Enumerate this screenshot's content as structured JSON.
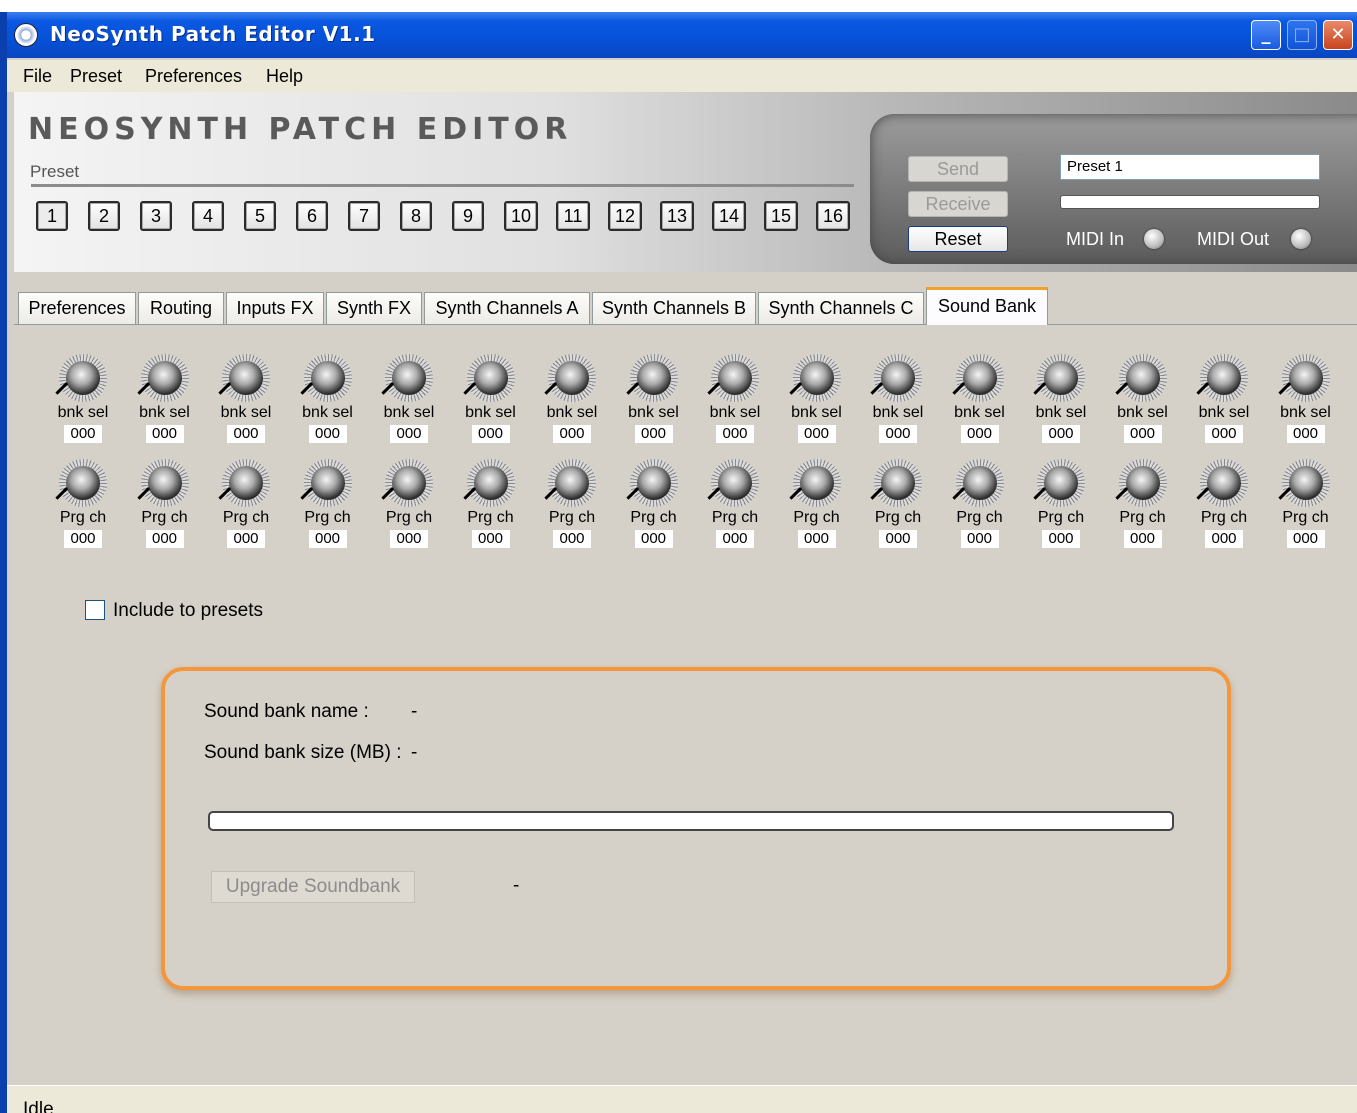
{
  "window": {
    "title": "NeoSynth Patch Editor V1.1"
  },
  "menu": [
    "File",
    "Preset",
    "Preferences",
    "Help"
  ],
  "header": {
    "banner_title": "NEOSYNTH PATCH EDITOR",
    "preset_label": "Preset",
    "preset_buttons": [
      "1",
      "2",
      "3",
      "4",
      "5",
      "6",
      "7",
      "8",
      "9",
      "10",
      "11",
      "12",
      "13",
      "14",
      "15",
      "16"
    ],
    "active_preset": "1",
    "send_label": "Send",
    "receive_label": "Receive",
    "reset_label": "Reset",
    "preset_name": "Preset 1",
    "midi_in_label": "MIDI In",
    "midi_out_label": "MIDI Out"
  },
  "tabs": [
    "Preferences",
    "Routing",
    "Inputs FX",
    "Synth FX",
    "Synth Channels A",
    "Synth Channels B",
    "Synth Channels C",
    "Sound Bank"
  ],
  "active_tab": "Sound Bank",
  "sound_bank": {
    "bank_select": {
      "label": "bnk sel",
      "values": [
        "000",
        "000",
        "000",
        "000",
        "000",
        "000",
        "000",
        "000",
        "000",
        "000",
        "000",
        "000",
        "000",
        "000",
        "000",
        "000"
      ]
    },
    "program_change": {
      "label": "Prg ch",
      "values": [
        "000",
        "000",
        "000",
        "000",
        "000",
        "000",
        "000",
        "000",
        "000",
        "000",
        "000",
        "000",
        "000",
        "000",
        "000",
        "000"
      ]
    },
    "include_to_presets_label": "Include to presets",
    "include_to_presets_checked": false,
    "name_label": "Sound bank name :",
    "name_value": "-",
    "size_label": "Sound bank size (MB) :",
    "size_value": "-",
    "upgrade_label": "Upgrade Soundbank",
    "upgrade_status": "-",
    "progress": 0
  },
  "status": {
    "text": "Idle"
  },
  "colors": {
    "accent_orange": "#f4963c",
    "titlebar_blue": "#0651d8",
    "panel_bg": "#d6d1c8"
  }
}
